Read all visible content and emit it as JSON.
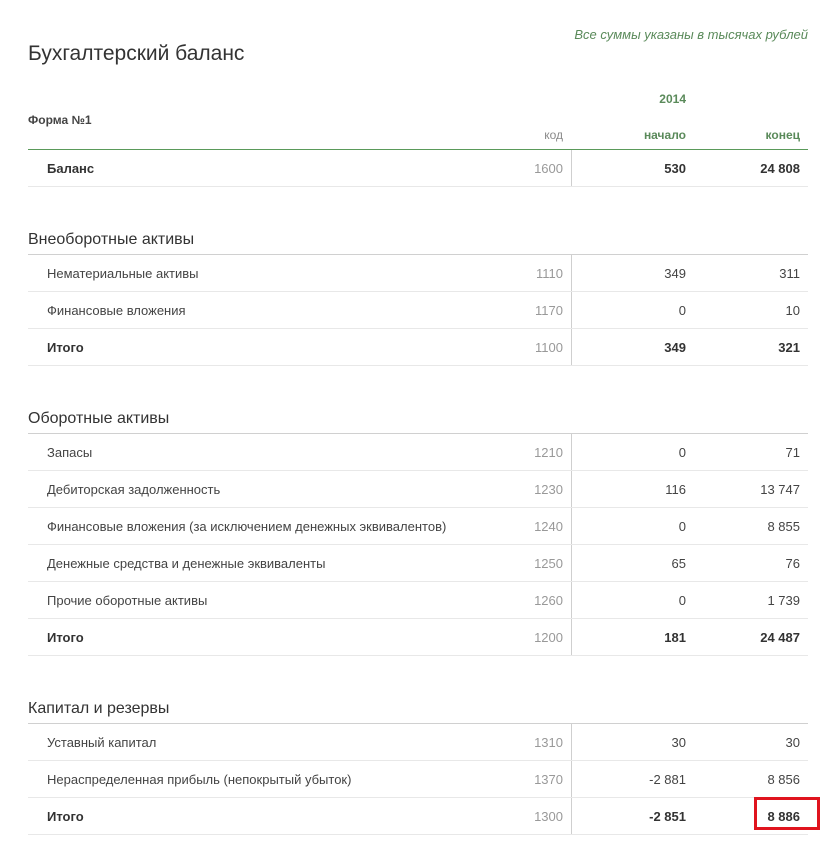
{
  "note": "Все суммы указаны в тысячах рублей",
  "title": "Бухгалтерский баланс",
  "header": {
    "form_label": "Форма №1",
    "year": "2014",
    "col_code": "код",
    "col_start": "начало",
    "col_end": "конец"
  },
  "balance": {
    "name": "Баланс",
    "code": "1600",
    "start": "530",
    "end": "24 808"
  },
  "sections": [
    {
      "title": "Внеоборотные активы",
      "rows": [
        {
          "name": "Нематериальные активы",
          "code": "1110",
          "start": "349",
          "end": "311"
        },
        {
          "name": "Финансовые вложения",
          "code": "1170",
          "start": "0",
          "end": "10"
        },
        {
          "name": "Итого",
          "code": "1100",
          "start": "349",
          "end": "321"
        }
      ]
    },
    {
      "title": "Оборотные активы",
      "rows": [
        {
          "name": "Запасы",
          "code": "1210",
          "start": "0",
          "end": "71"
        },
        {
          "name": "Дебиторская задолженность",
          "code": "1230",
          "start": "116",
          "end": "13 747"
        },
        {
          "name": "Финансовые вложения (за исключением денежных эквивалентов)",
          "code": "1240",
          "start": "0",
          "end": "8 855"
        },
        {
          "name": "Денежные средства и денежные эквиваленты",
          "code": "1250",
          "start": "65",
          "end": "76"
        },
        {
          "name": "Прочие оборотные активы",
          "code": "1260",
          "start": "0",
          "end": "1 739"
        },
        {
          "name": "Итого",
          "code": "1200",
          "start": "181",
          "end": "24 487"
        }
      ]
    },
    {
      "title": "Капитал и резервы",
      "rows": [
        {
          "name": "Уставный капитал",
          "code": "1310",
          "start": "30",
          "end": "30"
        },
        {
          "name": "Нераспределенная прибыль (непокрытый убыток)",
          "code": "1370",
          "start": "-2 881",
          "end": "8 856"
        },
        {
          "name": "Итого",
          "code": "1300",
          "start": "-2 851",
          "end": "8 886"
        }
      ]
    }
  ]
}
